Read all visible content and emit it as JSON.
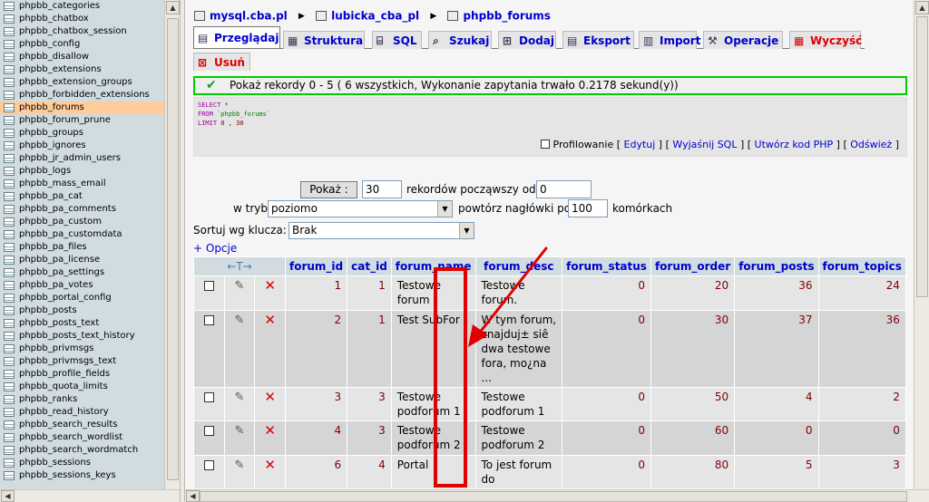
{
  "sidebar": {
    "tables": [
      {
        "name": "phpbb_categories"
      },
      {
        "name": "phpbb_chatbox"
      },
      {
        "name": "phpbb_chatbox_session"
      },
      {
        "name": "phpbb_config"
      },
      {
        "name": "phpbb_disallow"
      },
      {
        "name": "phpbb_extensions"
      },
      {
        "name": "phpbb_extension_groups"
      },
      {
        "name": "phpbb_forbidden_extensions"
      },
      {
        "name": "phpbb_forums",
        "active": true
      },
      {
        "name": "phpbb_forum_prune"
      },
      {
        "name": "phpbb_groups"
      },
      {
        "name": "phpbb_ignores"
      },
      {
        "name": "phpbb_jr_admin_users"
      },
      {
        "name": "phpbb_logs"
      },
      {
        "name": "phpbb_mass_email"
      },
      {
        "name": "phpbb_pa_cat"
      },
      {
        "name": "phpbb_pa_comments"
      },
      {
        "name": "phpbb_pa_custom"
      },
      {
        "name": "phpbb_pa_customdata"
      },
      {
        "name": "phpbb_pa_files"
      },
      {
        "name": "phpbb_pa_license"
      },
      {
        "name": "phpbb_pa_settings"
      },
      {
        "name": "phpbb_pa_votes"
      },
      {
        "name": "phpbb_portal_config"
      },
      {
        "name": "phpbb_posts"
      },
      {
        "name": "phpbb_posts_text"
      },
      {
        "name": "phpbb_posts_text_history"
      },
      {
        "name": "phpbb_privmsgs"
      },
      {
        "name": "phpbb_privmsgs_text"
      },
      {
        "name": "phpbb_profile_fields"
      },
      {
        "name": "phpbb_quota_limits"
      },
      {
        "name": "phpbb_ranks"
      },
      {
        "name": "phpbb_read_history"
      },
      {
        "name": "phpbb_search_results"
      },
      {
        "name": "phpbb_search_wordlist"
      },
      {
        "name": "phpbb_search_wordmatch"
      },
      {
        "name": "phpbb_sessions"
      },
      {
        "name": "phpbb_sessions_keys"
      }
    ]
  },
  "breadcrumb": {
    "server": "mysql.cba.pl",
    "database": "lubicka_cba_pl",
    "table": "phpbb_forums"
  },
  "tabs": [
    {
      "label": "Przeglądaj",
      "icon": "browse-icon",
      "active": true
    },
    {
      "label": "Struktura",
      "icon": "structure-icon"
    },
    {
      "label": "SQL",
      "icon": "sql-icon"
    },
    {
      "label": "Szukaj",
      "icon": "search-icon"
    },
    {
      "label": "Dodaj",
      "icon": "insert-icon"
    },
    {
      "label": "Eksport",
      "icon": "export-icon"
    },
    {
      "label": "Import",
      "icon": "import-icon"
    },
    {
      "label": "Operacje",
      "icon": "operations-icon"
    },
    {
      "label": "Wyczyść",
      "icon": "empty-icon",
      "danger": true
    },
    {
      "label": "Usuń",
      "icon": "drop-icon",
      "danger": true
    }
  ],
  "success_message": "Pokaż rekordy 0 - 5 ( 6 wszystkich, Wykonanie zapytania trwało 0.2178 sekund(y))",
  "sql": {
    "kw_select": "SELECT",
    "star": "*",
    "kw_from": "FROM",
    "table_name": "`phpbb_forums`",
    "kw_limit": "LIMIT",
    "limit_value": "0 , 30",
    "profiling_label": "Profilowanie",
    "links": [
      "Edytuj",
      "Wyjaśnij SQL",
      "Utwórz kod PHP",
      "Odśwież"
    ]
  },
  "nav_form": {
    "show_button": "Pokaż :",
    "rows_value": "30",
    "records_from_label": "rekordów począwszy od",
    "start_value": "0",
    "mode_label": "w trybie",
    "mode_value": "poziomo",
    "repeat_headers_label": "powtórz nagłówki po",
    "repeat_value": "100",
    "cells_label": "komórkach",
    "sort_label": "Sortuj wg klucza:",
    "sort_value": "Brak"
  },
  "options_link": "+ Opcje",
  "table": {
    "columns": [
      "forum_id",
      "cat_id",
      "forum_name",
      "forum_desc",
      "forum_status",
      "forum_order",
      "forum_posts",
      "forum_topics"
    ],
    "rows": [
      {
        "forum_id": "1",
        "cat_id": "1",
        "forum_name": [
          "Testowe",
          "forum"
        ],
        "forum_desc": [
          "Testowe",
          "forum."
        ],
        "forum_status": "0",
        "forum_order": "20",
        "forum_posts": "36",
        "forum_topics": "24"
      },
      {
        "forum_id": "2",
        "cat_id": "1",
        "forum_name": [
          "Test SubFor"
        ],
        "forum_desc": [
          "W tym forum,",
          "znajduj± siê",
          "dwa testowe",
          "fora, mo¿na",
          "..."
        ],
        "forum_status": "0",
        "forum_order": "30",
        "forum_posts": "37",
        "forum_topics": "36"
      },
      {
        "forum_id": "3",
        "cat_id": "3",
        "forum_name": [
          "Testowe",
          "podforum 1"
        ],
        "forum_desc": [
          "Testowe",
          "podforum 1"
        ],
        "forum_status": "0",
        "forum_order": "50",
        "forum_posts": "4",
        "forum_topics": "2"
      },
      {
        "forum_id": "4",
        "cat_id": "3",
        "forum_name": [
          "Testowe",
          "podforum 2"
        ],
        "forum_desc": [
          "Testowe",
          "podforum 2"
        ],
        "forum_status": "0",
        "forum_order": "60",
        "forum_posts": "0",
        "forum_topics": "0"
      },
      {
        "forum_id": "6",
        "cat_id": "4",
        "forum_name": [
          "Portal"
        ],
        "forum_desc": [
          "To jest forum",
          "do"
        ],
        "forum_status": "0",
        "forum_order": "80",
        "forum_posts": "5",
        "forum_topics": "3"
      }
    ]
  },
  "colors": {
    "sidebar_bg": "#D0DCE0",
    "active_table_bg": "#FFCC99",
    "link": "#0000CC",
    "success_border": "#00CC00",
    "annotation_red": "#E00000",
    "row_odd": "#E5E5E5",
    "row_even": "#D5D5D5"
  }
}
